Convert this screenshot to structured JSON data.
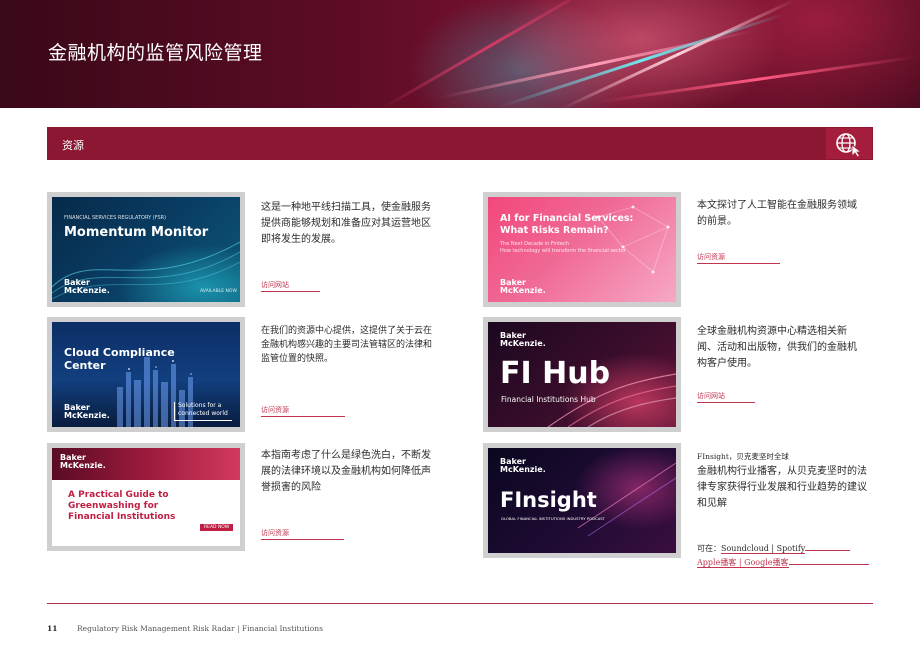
{
  "header": {
    "title": "金融机构的监管风险管理"
  },
  "section": {
    "label": "资源",
    "icon": "globe-cursor-icon"
  },
  "brand": {
    "name_line1": "Baker",
    "name_line2": "McKenzie.",
    "accent": "#8b1732",
    "link": "#c2354f"
  },
  "cards": [
    {
      "thumb": {
        "kicker": "FINANCIAL SERVICES REGULATORY (FSR)",
        "title": "Momentum Monitor",
        "badge": "AVAILABLE NOW"
      },
      "desc": "这是一种地平线扫描工具，使金融服务提供商能够规划和准备应对其运营地区即将发生的发展。",
      "link": "访问网站"
    },
    {
      "thumb": {
        "title_line1": "AI for Financial Services:",
        "title_line2": "What Risks Remain?",
        "sub_line1": "The Next Decade in Fintech",
        "sub_line2": "How technology will transform the financial sector"
      },
      "desc": "本文探讨了人工智能在金融服务领域的前景。",
      "link": "访问资源"
    },
    {
      "thumb": {
        "title_line1": "Cloud Compliance",
        "title_line2": "Center",
        "tag_line1": "Solutions for a",
        "tag_line2": "connected world"
      },
      "desc": "在我们的资源中心提供，这提供了关于云在金融机构感兴趣的主要司法管辖区的法律和监管位置的快照。",
      "link": "访问资源"
    },
    {
      "thumb": {
        "title": "FI Hub",
        "subtitle": "Financial Institutions Hub"
      },
      "desc": "全球金融机构资源中心精选相关新闻、活动和出版物，供我们的金融机构客户使用。",
      "link": "访问网站"
    },
    {
      "thumb": {
        "title_line1": "A Practical Guide to",
        "title_line2": "Greenwashing for",
        "title_line3": "Financial Institutions",
        "button": "READ NOW"
      },
      "desc": "本指南考虑了什么是绿色洗白，不断发展的法律环境以及金融机构如何降低声誉损害的风险",
      "link": "访问资源"
    },
    {
      "thumb": {
        "title": "FInsight",
        "subtitle": "GLOBAL FINANCIAL INSTITUTIONS INDUSTRY PODCAST"
      },
      "note": "FInsight，贝克麦坚时全球",
      "desc": "金融机构行业播客，从贝克麦坚时的法律专家获得行业发展和行业趋势的建议和见解",
      "avail_prefix": "可在：",
      "platforms": [
        "Soundcloud",
        "Spotify",
        "Apple播客",
        "Google播客"
      ]
    }
  ],
  "footer": {
    "page": "11",
    "text": "Regulatory Risk Management Risk Radar | Financial Institutions"
  }
}
